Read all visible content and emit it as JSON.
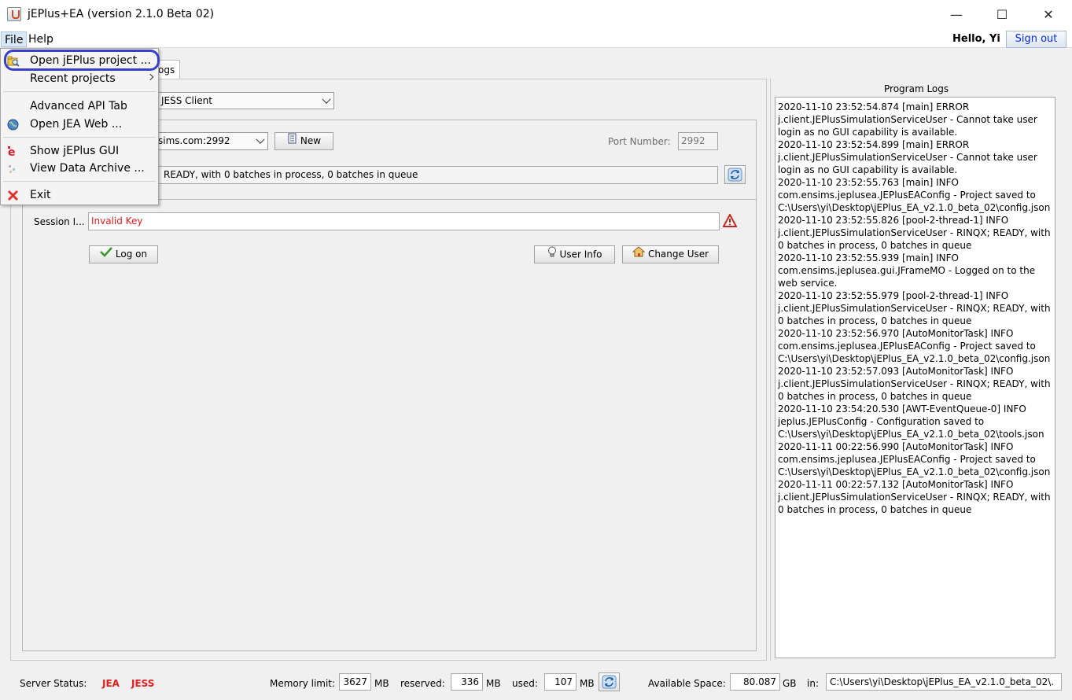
{
  "window": {
    "title": "jEPlus+EA (version 2.1.0 Beta 02)",
    "minimize": "—",
    "maximize": "☐",
    "close": "✕"
  },
  "menubar": {
    "file": "File",
    "help": "Help",
    "greeting": "Hello, Yi",
    "sign_out": "Sign out"
  },
  "file_menu": {
    "items": [
      {
        "label": "Open jEPlus project ...",
        "icon": "folder-search-icon"
      },
      {
        "label": "Recent projects",
        "icon": ""
      },
      {
        "label": "Advanced API Tab",
        "icon": ""
      },
      {
        "label": "Open JEA Web ...",
        "icon": "globe-icon"
      },
      {
        "label": "Show jEPlus GUI",
        "icon": "jeplus-logo-icon"
      },
      {
        "label": "View Data Archive ...",
        "icon": "archive-icon"
      },
      {
        "label": "Exit",
        "icon": "close-icon"
      }
    ]
  },
  "tab": {
    "label": "ogs"
  },
  "client_panel": {
    "client_type": "JESS Client",
    "server": "sims.com:2992",
    "new_button": "New",
    "port_label": "Port Number:",
    "port_value": "2992",
    "status_text": "READY, with 0 batches in process, 0 batches in queue",
    "session_label": "Session I...",
    "session_value": "Invalid Key",
    "logon_button": "Log on",
    "user_info_button": "User Info",
    "change_user_button": "Change User"
  },
  "logs": {
    "title": "Program Logs",
    "lines": [
      "2020-11-10 23:52:54.874 [main] ERROR j.client.JEPlusSimulationServiceUser - Cannot take user login as no GUI capability is available.",
      "2020-11-10 23:52:54.899 [main] ERROR j.client.JEPlusSimulationServiceUser - Cannot take user login as no GUI capability is available.",
      "2020-11-10 23:52:55.763 [main] INFO com.ensims.jeplusea.JEPlusEAConfig - Project saved to C:\\Users\\yi\\Desktop\\jEPlus_EA_v2.1.0_beta_02\\config.json",
      "2020-11-10 23:52:55.826 [pool-2-thread-1] INFO j.client.JEPlusSimulationServiceUser - RINQX; READY, with 0 batches in process, 0 batches in queue",
      "2020-11-10 23:52:55.939 [main] INFO com.ensims.jeplusea.gui.JFrameMO - Logged on to the web service.",
      "2020-11-10 23:52:55.979 [pool-2-thread-1] INFO j.client.JEPlusSimulationServiceUser - RINQX; READY, with 0 batches in process, 0 batches in queue",
      "2020-11-10 23:52:56.970 [AutoMonitorTask] INFO com.ensims.jeplusea.JEPlusEAConfig - Project saved to C:\\Users\\yi\\Desktop\\jEPlus_EA_v2.1.0_beta_02\\config.json",
      "2020-11-10 23:52:57.093 [AutoMonitorTask] INFO j.client.JEPlusSimulationServiceUser - RINQX; READY, with 0 batches in process, 0 batches in queue",
      "2020-11-10 23:54:20.530 [AWT-EventQueue-0] INFO jeplus.JEPlusConfig - Configuration saved to C:\\Users\\yi\\Desktop\\jEPlus_EA_v2.1.0_beta_02\\tools.json",
      "2020-11-11 00:22:56.990 [AutoMonitorTask] INFO com.ensims.jeplusea.JEPlusEAConfig - Project saved to C:\\Users\\yi\\Desktop\\jEPlus_EA_v2.1.0_beta_02\\config.json",
      "2020-11-11 00:22:57.132 [AutoMonitorTask] INFO j.client.JEPlusSimulationServiceUser - RINQX; READY, with 0 batches in process, 0 batches in queue"
    ]
  },
  "statusbar": {
    "server_status_label": "Server Status:",
    "jea": "JEA",
    "jess": "JESS",
    "memory_label": "Memory limit:",
    "memory_value": "3627",
    "mb1": "MB",
    "reserved_label": "reserved:",
    "reserved_value": "336",
    "mb2": "MB",
    "used_label": "used:",
    "used_value": "107",
    "mb3": "MB",
    "space_label": "Available Space:",
    "space_value": "80.087",
    "gb": "GB",
    "in_label": "in:",
    "path_value": "C:\\Users\\yi\\Desktop\\jEPlus_EA_v2.1.0_beta_02\\."
  },
  "colors": {
    "accent": "#3740c9",
    "error": "#e11d1d",
    "link": "#0a2bd6"
  }
}
